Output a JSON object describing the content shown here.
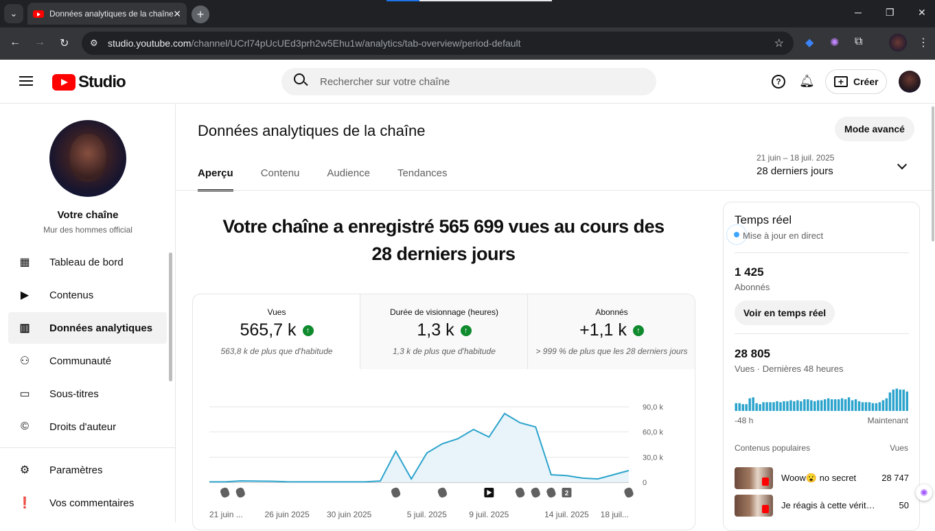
{
  "browser": {
    "tab_title": "Données analytiques de la chaîne",
    "url_host": "studio.youtube.com",
    "url_path": "/channel/UCrl74pUcUEd3prh2w5Ehu1w/analytics/tab-overview/period-default"
  },
  "header": {
    "logo_text": "Studio",
    "search_placeholder": "Rechercher sur votre chaîne",
    "create_label": "Créer"
  },
  "sidebar": {
    "channel_title": "Votre chaîne",
    "channel_name": "Mur des hommes official",
    "items": [
      {
        "label": "Tableau de bord",
        "icon": "dashboard-icon"
      },
      {
        "label": "Contenus",
        "icon": "content-icon"
      },
      {
        "label": "Données analytiques",
        "icon": "analytics-icon"
      },
      {
        "label": "Communauté",
        "icon": "community-icon"
      },
      {
        "label": "Sous-titres",
        "icon": "subtitles-icon"
      },
      {
        "label": "Droits d'auteur",
        "icon": "copyright-icon"
      },
      {
        "label": "Paramètres",
        "icon": "settings-icon"
      },
      {
        "label": "Vos commentaires",
        "icon": "feedback-icon"
      }
    ]
  },
  "main": {
    "title": "Données analytiques de la chaîne",
    "advanced_mode": "Mode avancé",
    "tabs": [
      "Aperçu",
      "Contenu",
      "Audience",
      "Tendances"
    ],
    "period_range": "21 juin – 18 juil. 2025",
    "period_label": "28 derniers jours",
    "headline_1": "Votre chaîne a enregistré 565 699 vues au cours des",
    "headline_2": "28 derniers jours",
    "stats": [
      {
        "label": "Vues",
        "value": "565,7 k",
        "compare": "563,8 k de plus que d'habitude"
      },
      {
        "label": "Durée de visionnage (heures)",
        "value": "1,3 k",
        "compare": "1,3 k de plus que d'habitude"
      },
      {
        "label": "Abonnés",
        "value": "+1,1 k",
        "compare": "> 999 % de plus que les 28 derniers jours"
      }
    ]
  },
  "chart_data": {
    "type": "area",
    "title": "",
    "x": [
      "21 juin",
      "22 juin",
      "23 juin",
      "24 juin",
      "25 juin",
      "26 juin",
      "27 juin",
      "28 juin",
      "29 juin",
      "30 juin",
      "1 juil.",
      "2 juil.",
      "3 juil.",
      "4 juil.",
      "5 juil.",
      "6 juil.",
      "7 juil.",
      "8 juil.",
      "9 juil.",
      "10 juil.",
      "11 juil.",
      "12 juil.",
      "13 juil.",
      "14 juil.",
      "15 juil.",
      "16 juil.",
      "17 juil.",
      "18 juil."
    ],
    "series": [
      {
        "values": [
          500,
          500,
          1600,
          1400,
          1200,
          600,
          500,
          500,
          500,
          500,
          500,
          1500,
          37000,
          4000,
          35000,
          46000,
          52000,
          63000,
          54000,
          82000,
          71000,
          66000,
          9000,
          8000,
          5000,
          4000,
          9000,
          14000
        ]
      }
    ],
    "x_tick_labels": [
      "21 juin ...",
      "26 juin 2025",
      "30 juin 2025",
      "5 juil. 2025",
      "9 juil. 2025",
      "14 juil. 2025",
      "18 juil..."
    ],
    "y_tick_labels": [
      "90,0 k",
      "60,0 k",
      "30,0 k",
      "0"
    ],
    "ylim": [
      0,
      90000
    ],
    "grid": true,
    "color": "#2ba3cc",
    "markers": [
      {
        "day": 1,
        "kind": "short",
        "label": ""
      },
      {
        "day": 2,
        "kind": "short",
        "label": ""
      },
      {
        "day": 12,
        "kind": "short",
        "label": ""
      },
      {
        "day": 15,
        "kind": "short",
        "label": ""
      },
      {
        "day": 18,
        "kind": "video",
        "label": ""
      },
      {
        "day": 20,
        "kind": "short",
        "label": ""
      },
      {
        "day": 21,
        "kind": "short",
        "label": ""
      },
      {
        "day": 22,
        "kind": "short",
        "label": ""
      },
      {
        "day": 23,
        "kind": "count",
        "label": "2"
      },
      {
        "day": 27,
        "kind": "short",
        "label": ""
      }
    ]
  },
  "realtime": {
    "title": "Temps réel",
    "live": "Mise à jour en direct",
    "subscribers_value": "1 425",
    "subscribers_label": "Abonnés",
    "button": "Voir en temps réel",
    "views_value": "28 805",
    "views_label": "Vues · Dernières 48 heures",
    "axis_start": "-48 h",
    "axis_end": "Maintenant",
    "bars": [
      8,
      8,
      7,
      7,
      13,
      14,
      8,
      7,
      9,
      9,
      9,
      9,
      10,
      9,
      10,
      10,
      11,
      10,
      11,
      10,
      12,
      12,
      11,
      10,
      11,
      11,
      12,
      13,
      12,
      12,
      12,
      13,
      12,
      14,
      11,
      12,
      10,
      9,
      9,
      9,
      8,
      8,
      9,
      11,
      13,
      19,
      22,
      23,
      22,
      22,
      20
    ],
    "popular_label": "Contenus populaires",
    "popular_views_label": "Vues",
    "popular": [
      {
        "title": "Woow😮 no secret",
        "views": "28 747"
      },
      {
        "title": "Je réagis à cette vérité difficile",
        "views": "50"
      }
    ]
  }
}
